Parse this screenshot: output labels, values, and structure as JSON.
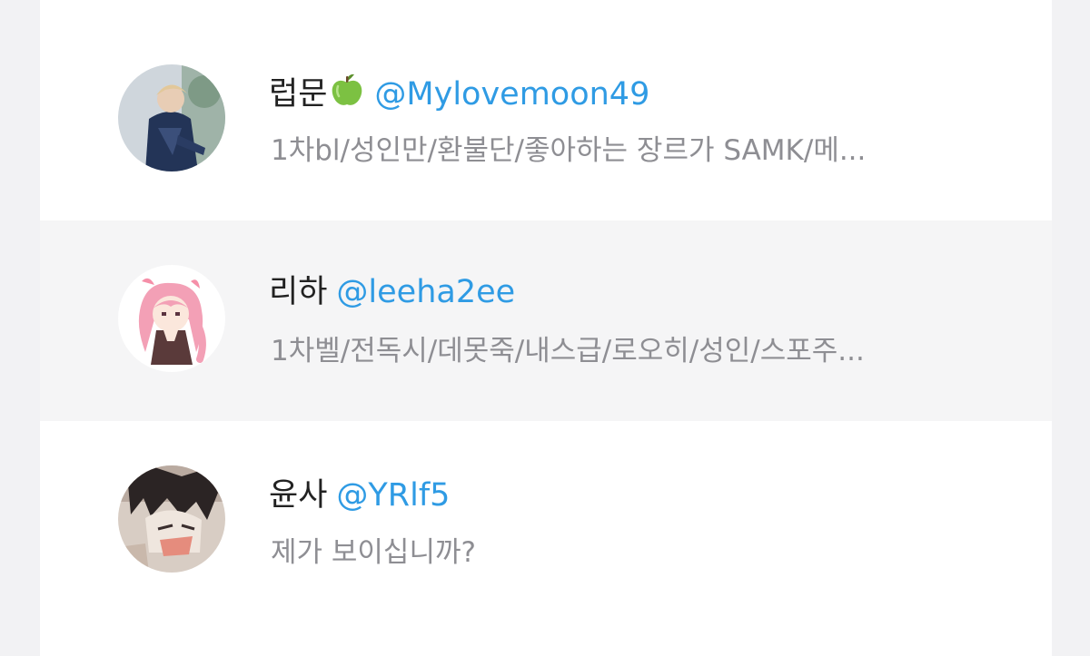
{
  "users": [
    {
      "name": "럽문",
      "emoji": "green-apple-icon",
      "handle": "@Mylovemoon49",
      "bio": "1차bl/성인만/환불단/좋아하는 장르가 SAMK/메..."
    },
    {
      "name": "리하",
      "handle": "@leeha2ee",
      "bio": "1차벨/전독시/데못죽/내스급/로오히/성인/스포주..."
    },
    {
      "name": "윤사",
      "handle": "@YRlf5",
      "bio": "제가 보이십니까?"
    }
  ],
  "colors": {
    "handle": "#2f9be4",
    "name": "#222222",
    "bio": "#8e8e93",
    "row_alt_bg": "#f5f5f6"
  }
}
